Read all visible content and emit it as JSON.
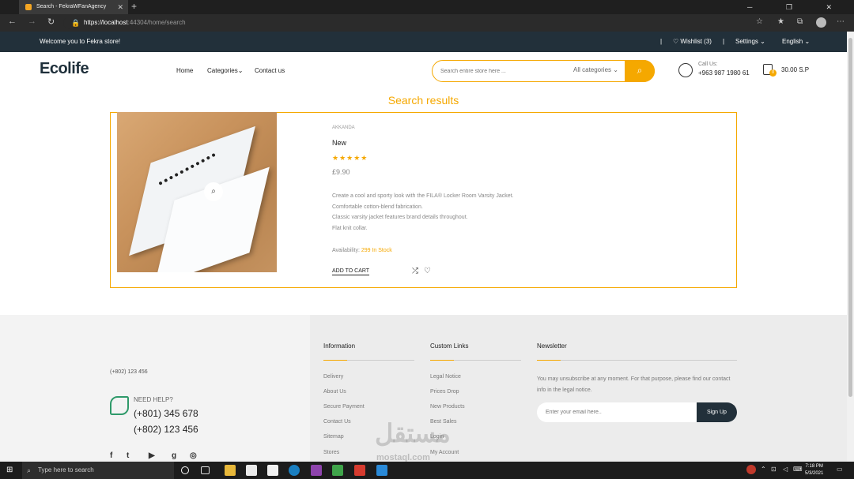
{
  "browser": {
    "tab_title": "Search - FekraWFanAgency",
    "tab_close": "✕",
    "new_tab": "+",
    "window_controls": "─ ❐ ✕",
    "url_host": "https://localhost",
    "url_path": ":44304/home/search"
  },
  "topbar": {
    "welcome": "Welcome you to Fekra store!",
    "wishlist": "Wishlist (3)",
    "settings": "Settings",
    "language": "English"
  },
  "header": {
    "logo": "Ecolife",
    "nav": [
      "Home",
      "Categories",
      "Contact us"
    ],
    "search_placeholder": "Search entire store here ...",
    "search_category": "All categories",
    "call_label": "Call Us:",
    "call_number": "+963 987 1980 61",
    "cart_count": "0",
    "cart_amount": "30.00 S.P"
  },
  "results": {
    "title": "Search results",
    "product": {
      "brand": "Akkanda",
      "name": "New",
      "stars": "★★★★★",
      "rating": 5,
      "price": "£9.90",
      "description": [
        "Create a cool and sporty look with the FILA® Locker Room Varsity Jacket.",
        "Comfortable cotton-blend fabrication.",
        "Classic varsity jacket features brand details throughout.",
        "Flat knit collar."
      ],
      "availability_label": "Availability:",
      "availability_value": "299 In Stock",
      "add_to_cart": "ADD TO CART"
    }
  },
  "footer": {
    "phone_small": "(+802) 123 456",
    "need_help": "NEED HELP?",
    "phone1": "(+801) 345 678",
    "phone2": "(+802) 123 456",
    "social": [
      "f",
      "t",
      "▶",
      "g",
      "◎"
    ],
    "information": {
      "title": "Information",
      "links": [
        "Delivery",
        "About Us",
        "Secure Payment",
        "Contact Us",
        "Sitemap",
        "Stores"
      ]
    },
    "custom_links": {
      "title": "Custom Links",
      "links": [
        "Legal Notice",
        "Prices Drop",
        "New Products",
        "Best Sales",
        "Login",
        "My Account"
      ]
    },
    "newsletter": {
      "title": "Newsletter",
      "text": "You may unsubscribe at any moment. For that purpose, please find our contact info in the legal notice.",
      "placeholder": "Enter your email here..",
      "button": "Sign Up"
    },
    "watermark": "مستقل",
    "watermark_sub": "mostaql.com"
  },
  "taskbar": {
    "search_text": "Type here to search",
    "time": "7:18 PM",
    "date": "5/3/2021"
  },
  "colors": {
    "accent": "#f5a800",
    "dark": "#22303a"
  }
}
